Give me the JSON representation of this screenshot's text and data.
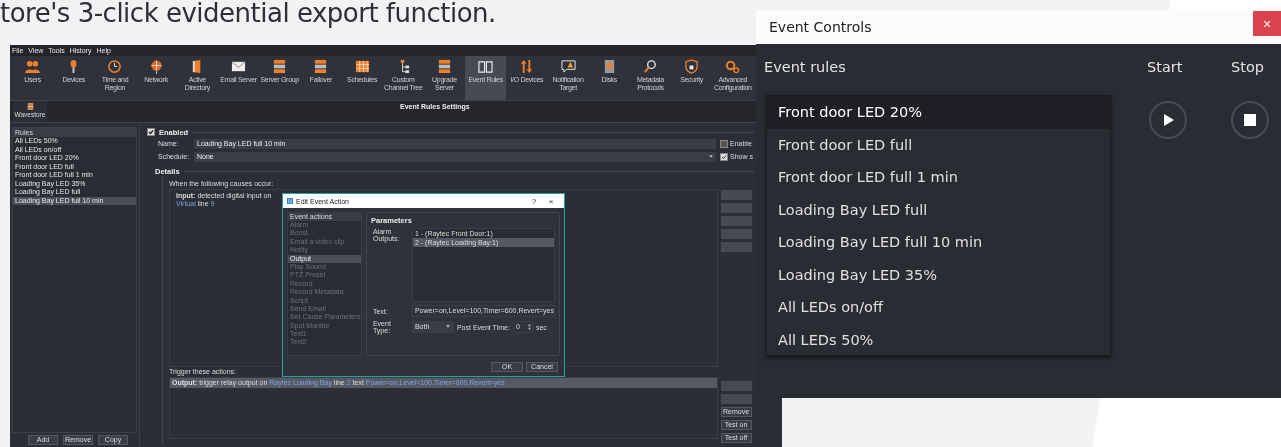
{
  "headline": "tore's 3-click evidential export function.",
  "server_window": {
    "menu": [
      "File",
      "View",
      "Tools",
      "History",
      "Help"
    ],
    "toolbar": [
      {
        "label": "Users",
        "selected": false
      },
      {
        "label": "Devices",
        "selected": false
      },
      {
        "label": "Time and Region",
        "selected": false
      },
      {
        "label": "Network",
        "selected": false
      },
      {
        "label": "Active Directory",
        "selected": false
      },
      {
        "label": "Email Server",
        "selected": false
      },
      {
        "label": "Server Group",
        "selected": false
      },
      {
        "label": "Failover",
        "selected": false
      },
      {
        "label": "Schedules",
        "selected": false
      },
      {
        "label": "Custom Channel Tree",
        "selected": false
      },
      {
        "label": "Upgrade Server",
        "selected": false
      },
      {
        "label": "Event Rules",
        "selected": true
      },
      {
        "label": "I/O Devices",
        "selected": false
      },
      {
        "label": "Notification Target",
        "selected": false
      },
      {
        "label": "Disks",
        "selected": false
      },
      {
        "label": "Metadata Protocols",
        "selected": false
      },
      {
        "label": "Security",
        "selected": false
      },
      {
        "label": "Advanced Configuration",
        "selected": false
      }
    ],
    "server_button": "Wavestore",
    "page_title": "Event Rules Settings",
    "rules_header": "Rules",
    "rules": [
      {
        "label": "All LEDs 50%",
        "selected": false
      },
      {
        "label": "All LEDs on/off",
        "selected": false
      },
      {
        "label": "Front door LED 20%",
        "selected": false
      },
      {
        "label": "Front door LED full",
        "selected": false
      },
      {
        "label": "Front door LED full 1 min",
        "selected": false
      },
      {
        "label": "Loading Bay LED 35%",
        "selected": false
      },
      {
        "label": "Loading Bay LED full",
        "selected": false
      },
      {
        "label": "Loading Bay LED full 10 min",
        "selected": true
      }
    ],
    "rule_buttons": [
      "Add",
      "Remove",
      "Copy"
    ],
    "enabled": {
      "label": "Enabled",
      "checked": true
    },
    "name": {
      "label": "Name:",
      "value": "Loading Bay LED full 10 min"
    },
    "schedule": {
      "label": "Schedule:",
      "value": "None"
    },
    "options": [
      {
        "label": "Enable",
        "checked": false
      },
      {
        "label": "Show s",
        "checked": true
      }
    ],
    "details_title": "Details",
    "causes_label": "When the following causes occur:",
    "cause": [
      {
        "kind": "bold",
        "text": "Input:"
      },
      {
        "kind": "plain",
        "text": " detected digital input on "
      },
      {
        "kind": "link",
        "text": "Virtual"
      },
      {
        "kind": "plain",
        "text": " line "
      },
      {
        "kind": "link",
        "text": "9"
      }
    ],
    "actions_label": "Trigger these actions:",
    "actions": [
      {
        "selected": true,
        "parts": [
          {
            "kind": "bold",
            "text": "Output:"
          },
          {
            "kind": "plain",
            "text": " trigger relay output on "
          },
          {
            "kind": "link",
            "text": "Raytec Loading Bay"
          },
          {
            "kind": "plain",
            "text": " line "
          },
          {
            "kind": "link",
            "text": "2"
          },
          {
            "kind": "plain",
            "text": " text "
          },
          {
            "kind": "link",
            "text": "Power=on,Level=100,Timer=600,Revert=yes"
          }
        ]
      }
    ],
    "action_buttons": [
      "Remove",
      "Test on",
      "Test off"
    ]
  },
  "dialog": {
    "title": "Edit Event Action",
    "help": "?",
    "close": "×",
    "list_header": "Event actions",
    "actions": [
      {
        "label": "Alarm",
        "disabled": true,
        "selected": false
      },
      {
        "label": "Boost",
        "disabled": true,
        "selected": false
      },
      {
        "label": "Email a video clip",
        "disabled": true,
        "selected": false
      },
      {
        "label": "Notify",
        "disabled": true,
        "selected": false
      },
      {
        "label": "Output",
        "disabled": false,
        "selected": true
      },
      {
        "label": "Play Sound",
        "disabled": true,
        "selected": false
      },
      {
        "label": "PTZ Preset",
        "disabled": true,
        "selected": false
      },
      {
        "label": "Record",
        "disabled": true,
        "selected": false
      },
      {
        "label": "Record Metadata",
        "disabled": true,
        "selected": false
      },
      {
        "label": "Script",
        "disabled": true,
        "selected": false
      },
      {
        "label": "Send Email",
        "disabled": true,
        "selected": false
      },
      {
        "label": "Set Cause Parameters",
        "disabled": true,
        "selected": false
      },
      {
        "label": "Spot Monitor",
        "disabled": true,
        "selected": false
      },
      {
        "label": "Text1",
        "disabled": true,
        "selected": false
      },
      {
        "label": "Text2",
        "disabled": true,
        "selected": false
      }
    ],
    "parameters_title": "Parameters",
    "alarm_outputs_label": "Alarm Outputs:",
    "alarm_outputs": [
      {
        "label": "1 - (Raytec Front Door:1)",
        "selected": false
      },
      {
        "label": "2 - (Raytec Loading Bay:1)",
        "selected": true
      }
    ],
    "text_label": "Text:",
    "text_value": "Power=on,Level=100,Timer=600,Revert=yes",
    "event_type_label": "Event Type:",
    "event_type": "Both",
    "post_event_label": "Post Event Time:",
    "post_event_value": "0",
    "post_event_unit": "sec",
    "buttons": [
      "OK",
      "Cancel"
    ]
  },
  "event_controls": {
    "title": "Event Controls",
    "close": "×",
    "rules_label": "Event rules",
    "start_label": "Start",
    "stop_label": "Stop",
    "rules": [
      {
        "label": "Front door LED 20%",
        "selected": true
      },
      {
        "label": "Front door LED full",
        "selected": false
      },
      {
        "label": "Front door LED full 1 min",
        "selected": false
      },
      {
        "label": "Loading Bay LED full",
        "selected": false
      },
      {
        "label": "Loading Bay LED full 10 min",
        "selected": false
      },
      {
        "label": "Loading Bay LED 35%",
        "selected": false
      },
      {
        "label": "All LEDs on/off",
        "selected": false
      },
      {
        "label": "All LEDs 50%",
        "selected": false
      }
    ]
  }
}
